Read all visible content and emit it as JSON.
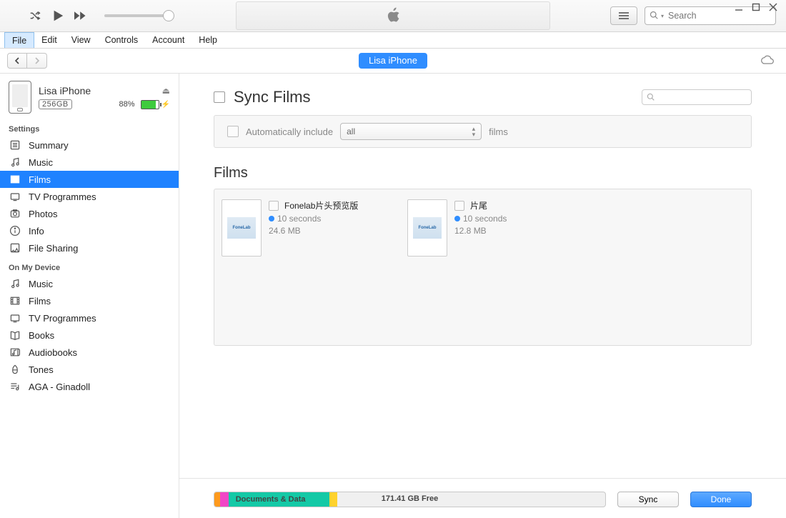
{
  "search_placeholder": "Search",
  "menu": [
    "File",
    "Edit",
    "View",
    "Controls",
    "Account",
    "Help"
  ],
  "menu_active_index": 0,
  "location_pill": "Lisa iPhone",
  "device": {
    "name": "Lisa iPhone",
    "capacity": "256GB",
    "battery_pct": "88%"
  },
  "sidebar": {
    "settings_header": "Settings",
    "settings": [
      {
        "label": "Summary",
        "icon": "summary"
      },
      {
        "label": "Music",
        "icon": "music"
      },
      {
        "label": "Films",
        "icon": "films",
        "active": true
      },
      {
        "label": "TV Programmes",
        "icon": "tv"
      },
      {
        "label": "Photos",
        "icon": "photos"
      },
      {
        "label": "Info",
        "icon": "info"
      },
      {
        "label": "File Sharing",
        "icon": "filesharing"
      }
    ],
    "device_header": "On My Device",
    "device_items": [
      {
        "label": "Music",
        "icon": "music"
      },
      {
        "label": "Films",
        "icon": "films"
      },
      {
        "label": "TV Programmes",
        "icon": "tv"
      },
      {
        "label": "Books",
        "icon": "books"
      },
      {
        "label": "Audiobooks",
        "icon": "audiobooks"
      },
      {
        "label": "Tones",
        "icon": "tones"
      },
      {
        "label": "AGA - Ginadoll",
        "icon": "playlist"
      }
    ]
  },
  "content": {
    "sync_title": "Sync Films",
    "auto_text_pre": "Automatically include",
    "auto_dropdown": "all",
    "auto_text_post": "films",
    "films_heading": "Films",
    "films": [
      {
        "name": "Fonelab片头预览版",
        "duration": "10 seconds",
        "size": "24.6 MB",
        "thumb_text": "FoneLab"
      },
      {
        "name": "片尾",
        "duration": "10 seconds",
        "size": "12.8 MB",
        "thumb_text": "FoneLab"
      }
    ]
  },
  "bottom": {
    "docs_label": "Documents & Data",
    "free_label": "171.41 GB Free",
    "sync_btn": "Sync",
    "done_btn": "Done"
  }
}
